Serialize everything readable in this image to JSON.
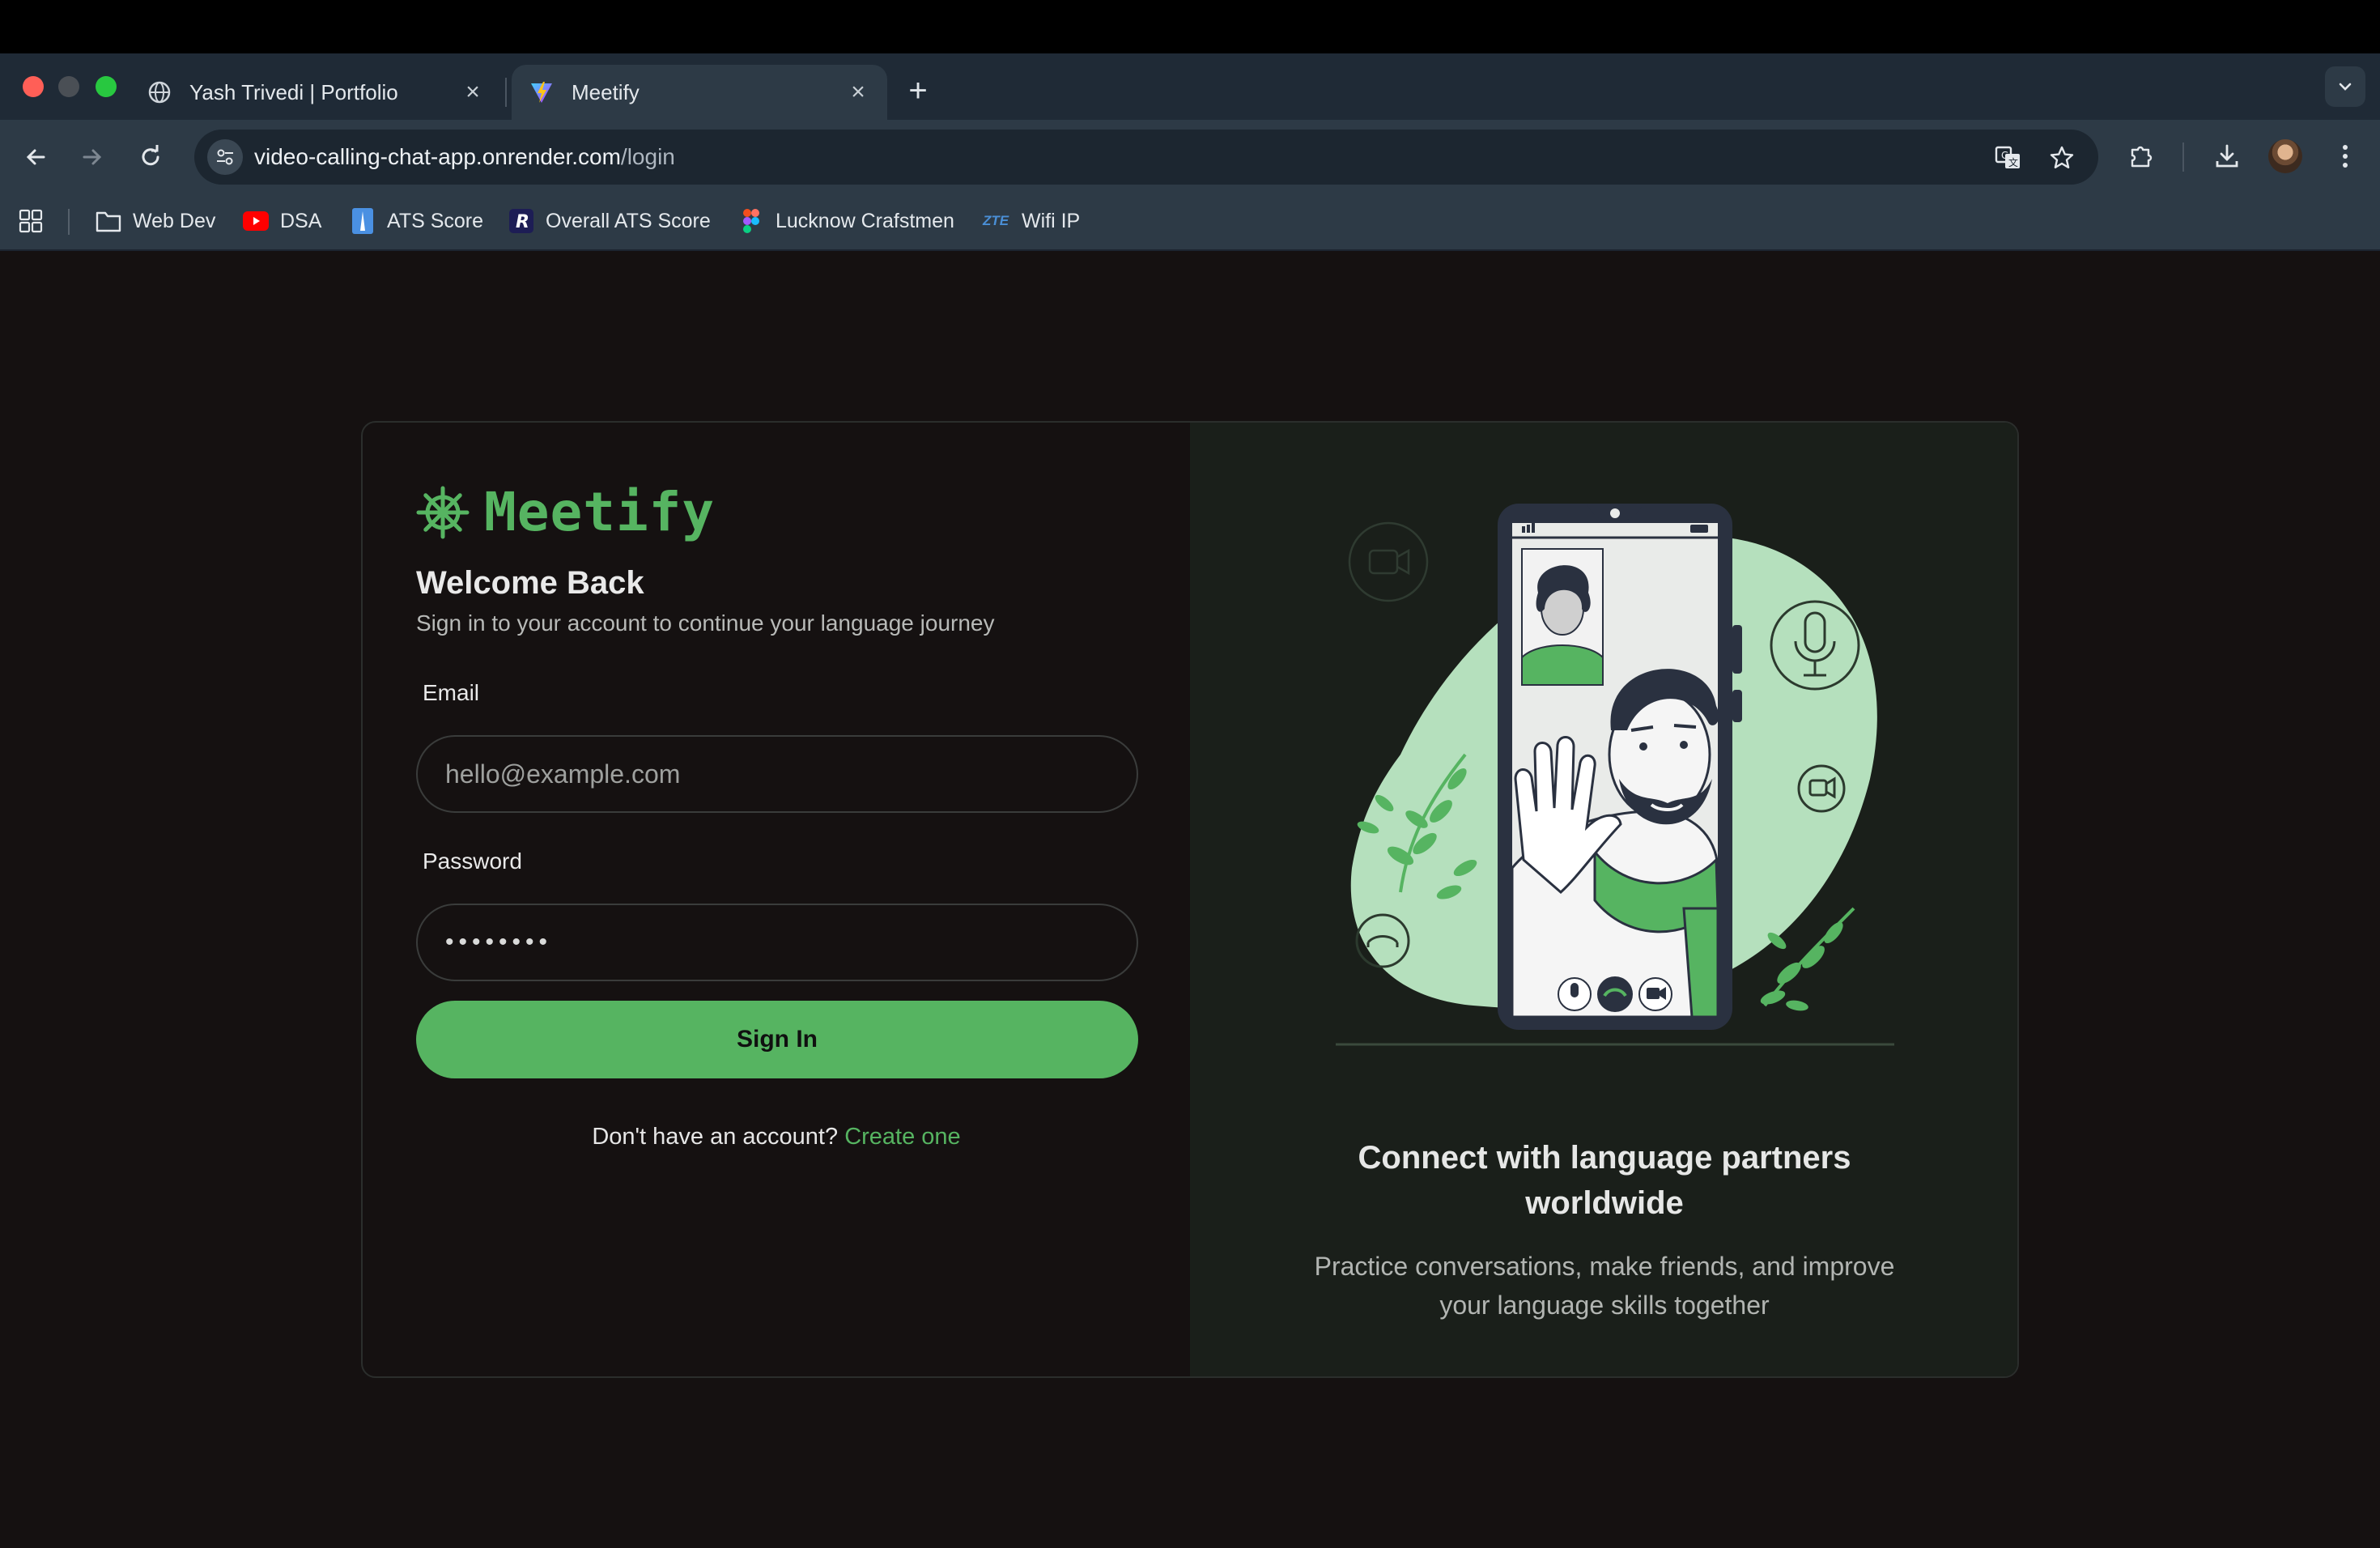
{
  "browser": {
    "tabs": [
      {
        "title": "Yash Trivedi | Portfolio",
        "active": false
      },
      {
        "title": "Meetify",
        "active": true
      }
    ],
    "url": {
      "host": "video-calling-chat-app.onrender.com",
      "path": "/login"
    },
    "bookmarks": [
      {
        "label": "Web Dev",
        "icon": "folder-icon"
      },
      {
        "label": "DSA",
        "icon": "youtube-icon"
      },
      {
        "label": "ATS Score",
        "icon": "ats-icon"
      },
      {
        "label": "Overall ATS Score",
        "icon": "r-logo-icon"
      },
      {
        "label": "Lucknow Crafstmen",
        "icon": "figma-icon"
      },
      {
        "label": "Wifi IP",
        "icon": "zte-icon"
      }
    ],
    "zte_text": "ZTE"
  },
  "login": {
    "brand": "Meetify",
    "welcome": "Welcome Back",
    "subtitle": "Sign in to your account to continue your language journey",
    "email_label": "Email",
    "email_placeholder": "hello@example.com",
    "password_label": "Password",
    "password_value": "••••••••",
    "signin_label": "Sign In",
    "no_account": "Don't have an account?",
    "create_link": "Create one"
  },
  "promo": {
    "headline_line1": "Connect with language partners",
    "headline_line2": "worldwide",
    "tagline_line1": "Practice conversations, make friends, and improve",
    "tagline_line2": "your language skills together"
  },
  "colors": {
    "accent": "#56b461",
    "page_bg": "#151111",
    "panel_bg": "#1a1f1a",
    "illustration_blob": "#b5e0bd"
  }
}
